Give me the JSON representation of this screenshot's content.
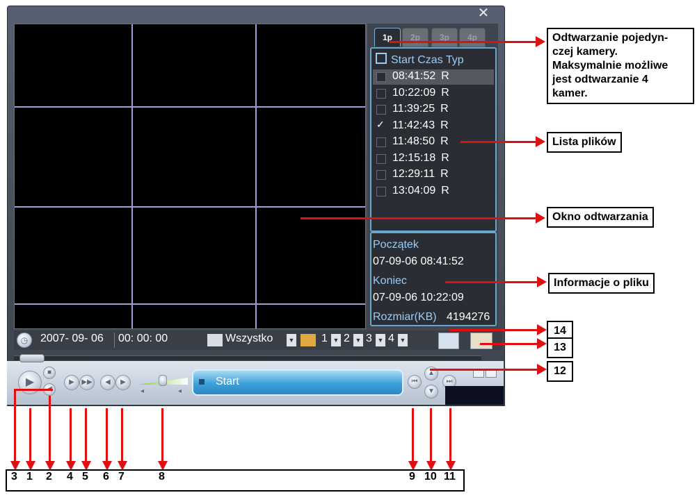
{
  "tabs": [
    "1p",
    "2p",
    "3p",
    "4p"
  ],
  "file_list": {
    "header": "Start Czas Typ",
    "rows": [
      {
        "time": "08:41:52",
        "type": "R",
        "checked": false
      },
      {
        "time": "10:22:09",
        "type": "R",
        "checked": false
      },
      {
        "time": "11:39:25",
        "type": "R",
        "checked": false
      },
      {
        "time": "11:42:43",
        "type": "R",
        "checked": true
      },
      {
        "time": "11:48:50",
        "type": "R",
        "checked": false
      },
      {
        "time": "12:15:18",
        "type": "R",
        "checked": false
      },
      {
        "time": "12:29:11",
        "type": "R",
        "checked": false
      },
      {
        "time": "13:04:09",
        "type": "R",
        "checked": false
      }
    ]
  },
  "file_info": {
    "start_label": "Początek",
    "start_value": "07-09-06 08:41:52",
    "end_label": "Koniec",
    "end_value": "07-09-06 10:22:09",
    "size_label": "Rozmiar(KB)",
    "size_value": "4194276"
  },
  "toolbar": {
    "date": "2007- 09- 06",
    "time": "00: 00: 00",
    "type_filter": "Wszystko",
    "channels": [
      "1",
      "2",
      "3",
      "4"
    ]
  },
  "controls": {
    "start_label": "Start"
  },
  "callouts": {
    "single_camera": [
      "Odtwarzanie pojedyn-",
      "czej kamery.",
      "Maksymalnie możliwe",
      "jest odtwarzanie 4",
      "kamer."
    ],
    "file_list": "Lista plików",
    "playback_window": "Okno odtwarzania",
    "file_info": "Informacje o pliku",
    "n14": "14",
    "n13": "13",
    "n12": "12"
  },
  "bottom_numbers": [
    "3",
    "1",
    "2",
    "4",
    "5",
    "6",
    "7",
    "8",
    "9",
    "10",
    "11"
  ],
  "colors": {
    "annotation_red": "#e01010",
    "grid_line": "#a89ad8",
    "panel_border": "#6aa7cf",
    "label_blue": "#9ecbf2"
  }
}
